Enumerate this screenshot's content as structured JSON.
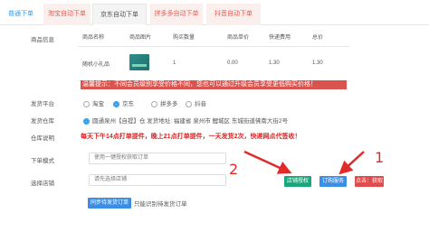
{
  "tabs": [
    "普通下单",
    "淘宝自动下单",
    "京东自动下单",
    "拼多多自动下单",
    "抖音自动下单"
  ],
  "labels": {
    "product": "商品信息",
    "platform": "发货平台",
    "warehouse": "发货仓库",
    "warehouse_note": "仓库说明",
    "order_mode": "下单模式",
    "shop": "选择店铺"
  },
  "table": {
    "headers": [
      "商品名称",
      "商品图片",
      "购买数量",
      "商品单价",
      "快递费用",
      "总价"
    ],
    "row": [
      "随机小礼品",
      "",
      "1",
      "0.00",
      "1.30",
      "1.30"
    ]
  },
  "warning": "温馨提示：不同会员级别享受价格不同，您也可以通过升级会员享受更低购买价格！",
  "platforms": [
    "淘宝",
    "京东",
    "拼多多",
    "抖音"
  ],
  "platform_selected": "京东",
  "address": "圆通泉州【自提】仓  发货地址: 福建省 泉州市 鲤城区 东城街道佛南大街2号",
  "notice": "每天下午14点打单提件，晚上21点打单提件，一天发货2次，快递网点代签收！",
  "order_mode_value": "使用一键授权获取订单",
  "shop_placeholder": "请先选择店铺",
  "buttons": {
    "shop_auth": "店铺授权",
    "order_service": "订购服务",
    "login": "点击：获取",
    "sync": "同步待发货订单"
  },
  "recognize_link": "只能识别待发货订单",
  "annotations": {
    "one": "1",
    "two": "2"
  },
  "colors": {
    "accent_blue": "#2e9df0",
    "red": "#e01f1f",
    "green": "#1aa67b"
  }
}
